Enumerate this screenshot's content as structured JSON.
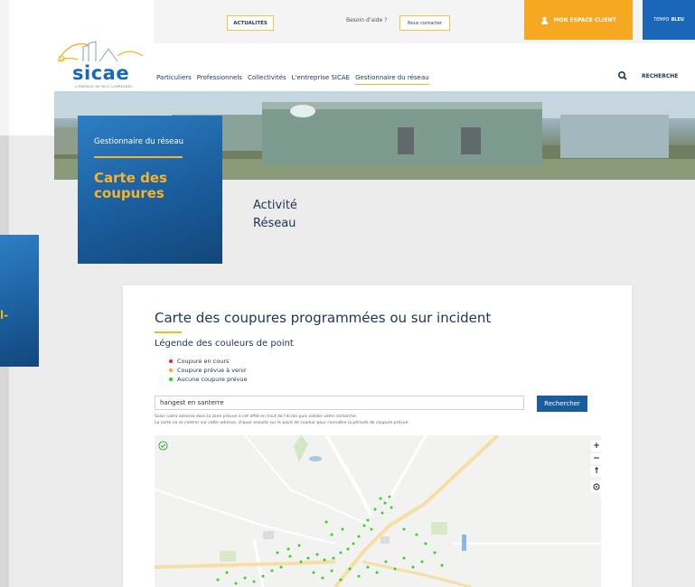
{
  "brand": {
    "name": "sicae",
    "tagline": "L'ÉNERGIE DE NOS CAMPAGNES"
  },
  "topbar": {
    "actualites": "ACTUALITÉS",
    "help": "Besoin d'aide ?",
    "contact": "Nous contacter",
    "client_space": "MON ESPACE CLIENT",
    "tempo_prefix": "TEMPO",
    "tempo_color": "BLEU"
  },
  "nav": {
    "items": [
      "Particuliers",
      "Professionnels",
      "Collectivités",
      "L'entreprise SICAE",
      "Gestionnaire du réseau"
    ],
    "search": "RECHERCHE"
  },
  "hero": {
    "breadcrumb": "Gestionnaire du réseau",
    "title_line1": "Carte des",
    "title_line2": "coupures",
    "activity_line1": "Activité",
    "activity_line2": "Réseau"
  },
  "side": {
    "char": "l-"
  },
  "panel": {
    "title": "Carte des coupures programmées ou sur incident",
    "legend_title": "Légende des couleurs de point",
    "legend": [
      {
        "label": "Coupure en cours",
        "color": "#e3261e"
      },
      {
        "label": "Coupure prévue à venir",
        "color": "#f7a823"
      },
      {
        "label": "Aucune coupure prévue",
        "color": "#2bd11b"
      }
    ],
    "address_value": "hangest en santerre",
    "search_button": "Rechercher",
    "help_line1": "Saisir votre adresse dans la zone prévue à cet effet en haut de l'écran puis valider votre recherche.",
    "help_line2": "La carte va se centrer sur cette adresse, cliquer ensuite sur le point de couleur pour connaître la période de coupure prévue."
  },
  "map_controls": [
    "+",
    "−",
    "↑"
  ],
  "colors": {
    "brand_blue": "#1a5d9d",
    "accent_yellow": "#f7b32b",
    "orange": "#f7a823"
  }
}
